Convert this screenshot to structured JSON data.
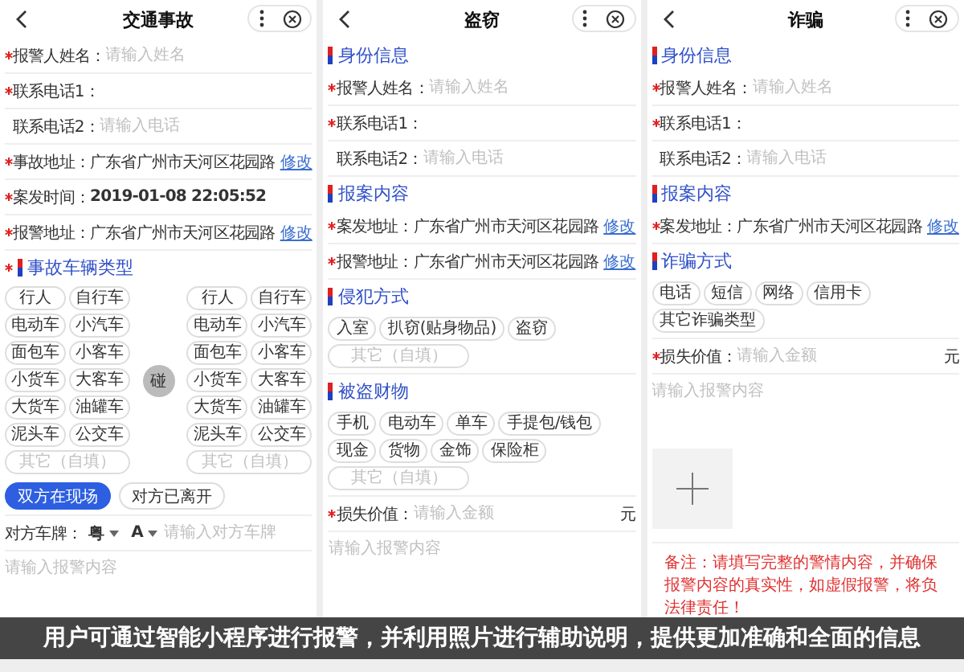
{
  "panels": [
    {
      "title": "交通事故",
      "blocks": [
        {
          "kind": "field",
          "required": true,
          "label": "报警人姓名：",
          "placeholder": "请输入姓名"
        },
        {
          "kind": "field",
          "required": true,
          "label": "联系电话1："
        },
        {
          "kind": "field",
          "required": false,
          "label": "联系电话2：",
          "placeholder": "请输入电话"
        },
        {
          "kind": "field",
          "required": true,
          "label": "事故地址：",
          "value": "广东省广州市天河区花园路",
          "link": "修改"
        },
        {
          "kind": "datetime",
          "required": true,
          "label": "案发时间：",
          "value": "2019-01-08 22:05:52"
        },
        {
          "kind": "field",
          "required": true,
          "label": "报警地址：",
          "value": "广东省广州市天河区花园路",
          "link": "修改"
        },
        {
          "kind": "section",
          "required": true,
          "title": "事故车辆类型"
        },
        {
          "kind": "vehicles",
          "center": "碰",
          "groups": [
            {
              "chips": [
                {
                  "label": "行人",
                  "selected": false
                },
                {
                  "label": "自行车",
                  "selected": false
                },
                {
                  "label": "电动车",
                  "selected": false
                },
                {
                  "label": "小汽车",
                  "selected": false
                },
                {
                  "label": "面包车",
                  "selected": false
                },
                {
                  "label": "小客车",
                  "selected": false
                },
                {
                  "label": "小货车",
                  "selected": false
                },
                {
                  "label": "大客车",
                  "selected": false
                },
                {
                  "label": "大货车",
                  "selected": false
                },
                {
                  "label": "油罐车",
                  "selected": false
                },
                {
                  "label": "泥头车",
                  "selected": false
                },
                {
                  "label": "公交车",
                  "selected": false
                }
              ],
              "other_placeholder": "其它（自填）"
            },
            {
              "chips": [
                {
                  "label": "行人",
                  "selected": false
                },
                {
                  "label": "自行车",
                  "selected": false
                },
                {
                  "label": "电动车",
                  "selected": false
                },
                {
                  "label": "小汽车",
                  "selected": false
                },
                {
                  "label": "面包车",
                  "selected": false
                },
                {
                  "label": "小客车",
                  "selected": false
                },
                {
                  "label": "小货车",
                  "selected": false
                },
                {
                  "label": "大客车",
                  "selected": false
                },
                {
                  "label": "大货车",
                  "selected": false
                },
                {
                  "label": "油罐车",
                  "selected": false
                },
                {
                  "label": "泥头车",
                  "selected": false
                },
                {
                  "label": "公交车",
                  "selected": false
                }
              ],
              "other_placeholder": "其它（自填）"
            }
          ]
        },
        {
          "kind": "toggle",
          "options": [
            {
              "label": "双方在现场",
              "selected": true
            },
            {
              "label": "对方已离开",
              "selected": false
            }
          ]
        },
        {
          "kind": "plate",
          "label": "对方车牌：",
          "province": "粤",
          "letter": "A",
          "placeholder": "请输入对方车牌"
        },
        {
          "kind": "textarea",
          "placeholder": "请输入报警内容"
        }
      ]
    },
    {
      "title": "盗窃",
      "blocks": [
        {
          "kind": "section",
          "required": false,
          "title": "身份信息"
        },
        {
          "kind": "field",
          "required": true,
          "label": "报警人姓名：",
          "placeholder": "请输入姓名"
        },
        {
          "kind": "field",
          "required": true,
          "label": "联系电话1："
        },
        {
          "kind": "field",
          "required": false,
          "label": "联系电话2：",
          "placeholder": "请输入电话"
        },
        {
          "kind": "section",
          "required": false,
          "title": "报案内容"
        },
        {
          "kind": "field",
          "required": true,
          "label": "案发地址：",
          "value": "广东省广州市天河区花园路",
          "link": "修改"
        },
        {
          "kind": "field",
          "required": true,
          "label": "报警地址：",
          "value": "广东省广州市天河区花园路",
          "link": "修改"
        },
        {
          "kind": "section",
          "required": false,
          "title": "侵犯方式"
        },
        {
          "kind": "chips",
          "chips": [
            {
              "label": "入室",
              "selected": false
            },
            {
              "label": "扒窃(贴身物品)",
              "selected": false
            },
            {
              "label": "盗窃",
              "selected": false
            }
          ],
          "other_placeholder": "其它（自填）"
        },
        {
          "kind": "section",
          "required": false,
          "title": "被盗财物"
        },
        {
          "kind": "chips",
          "chips": [
            {
              "label": "手机",
              "selected": false
            },
            {
              "label": "电动车",
              "selected": false
            },
            {
              "label": "单车",
              "selected": false
            },
            {
              "label": "手提包/钱包",
              "selected": false
            },
            {
              "label": "现金",
              "selected": false
            },
            {
              "label": "货物",
              "selected": false
            },
            {
              "label": "金饰",
              "selected": false
            },
            {
              "label": "保险柜",
              "selected": false
            }
          ],
          "other_placeholder": "其它（自填）"
        },
        {
          "kind": "amount",
          "required": true,
          "label": "损失价值：",
          "placeholder": "请输入金额",
          "unit": "元"
        },
        {
          "kind": "textarea",
          "placeholder": "请输入报警内容"
        }
      ]
    },
    {
      "title": "诈骗",
      "blocks": [
        {
          "kind": "section",
          "required": false,
          "title": "身份信息"
        },
        {
          "kind": "field",
          "required": true,
          "label": "报警人姓名：",
          "placeholder": "请输入姓名"
        },
        {
          "kind": "field",
          "required": true,
          "label": "联系电话1："
        },
        {
          "kind": "field",
          "required": false,
          "label": "联系电话2：",
          "placeholder": "请输入电话"
        },
        {
          "kind": "section",
          "required": false,
          "title": "报案内容"
        },
        {
          "kind": "field",
          "required": true,
          "label": "案发地址：",
          "value": "广东省广州市天河区花园路",
          "link": "修改"
        },
        {
          "kind": "section",
          "required": false,
          "title": "诈骗方式"
        },
        {
          "kind": "chips",
          "chips": [
            {
              "label": "电话",
              "selected": false
            },
            {
              "label": "短信",
              "selected": false
            },
            {
              "label": "网络",
              "selected": false
            },
            {
              "label": "信用卡",
              "selected": false
            },
            {
              "label": "其它诈骗类型",
              "selected": false
            }
          ]
        },
        {
          "kind": "amount",
          "required": true,
          "label": "损失价值：",
          "placeholder": "请输入金额",
          "unit": "元"
        },
        {
          "kind": "textarea",
          "placeholder": "请输入报警内容"
        },
        {
          "kind": "upload"
        },
        {
          "kind": "note",
          "text": "备注：请填写完整的警情内容，并确保报警内容的真实性，如虚假报警，将负法律责任！"
        }
      ]
    }
  ],
  "caption": "用户可通过智能小程序进行报警，并利用照片进行辅助说明，提供更加准确和全面的信息"
}
